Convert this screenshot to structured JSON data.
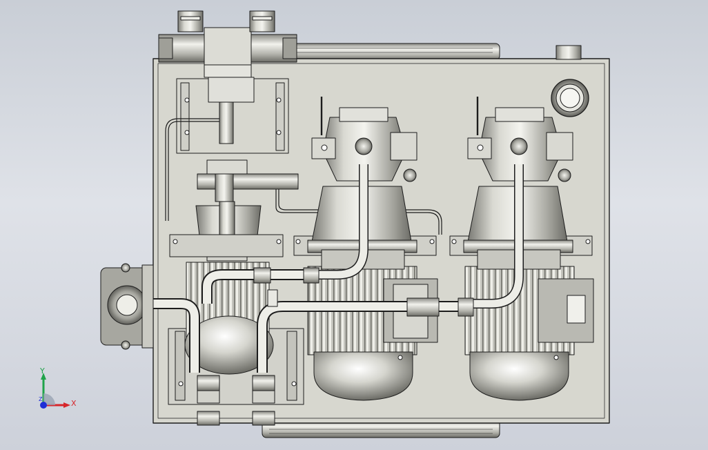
{
  "scene": {
    "viewer_background": "#d3d7de",
    "line_color": "#1c1c1c",
    "metal_light": "#e9e9e3",
    "metal_mid": "#b8b8b0",
    "metal_dark": "#6f6f69",
    "plate_color": "#d8d8d0"
  },
  "triad": {
    "x_label": "X",
    "y_label": "Y",
    "z_label": "Z",
    "x_color": "#d6262b",
    "y_color": "#1fa34a",
    "z_color": "#1f2fd6"
  },
  "parts": {
    "motor_pump_units": 2,
    "solenoid_valves": 1,
    "relief_valves": 2
  }
}
